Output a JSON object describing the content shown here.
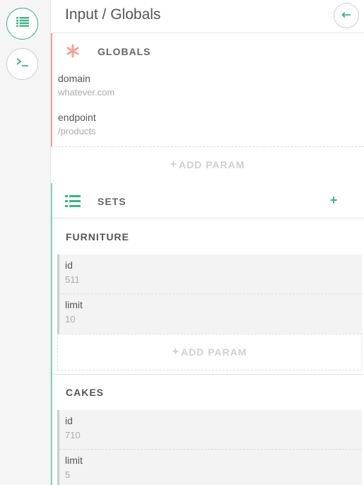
{
  "colors": {
    "accent": "#3cb487",
    "globals_accent": "#f1a595",
    "sets_accent": "#8bd3b6"
  },
  "sidebar": {
    "buttons": [
      {
        "icon": "list-icon",
        "active": true
      },
      {
        "icon": "terminal-icon",
        "active": false
      }
    ]
  },
  "header": {
    "title": "Input / Globals",
    "back_icon": "arrow-left-icon"
  },
  "globals": {
    "label": "GLOBALS",
    "icon": "asterisk-icon",
    "params": [
      {
        "key": "domain",
        "value": "whatever.com"
      },
      {
        "key": "endpoint",
        "value": "/products"
      }
    ],
    "add_param_label": "ADD PARAM"
  },
  "sets": {
    "label": "SETS",
    "icon": "list-icon",
    "add_icon": "plus-icon",
    "items": [
      {
        "name": "FURNITURE",
        "params": [
          {
            "key": "id",
            "value": "511"
          },
          {
            "key": "limit",
            "value": "10"
          }
        ],
        "add_param_label": "ADD PARAM"
      },
      {
        "name": "CAKES",
        "params": [
          {
            "key": "id",
            "value": "710"
          },
          {
            "key": "limit",
            "value": "5"
          }
        ]
      }
    ]
  }
}
